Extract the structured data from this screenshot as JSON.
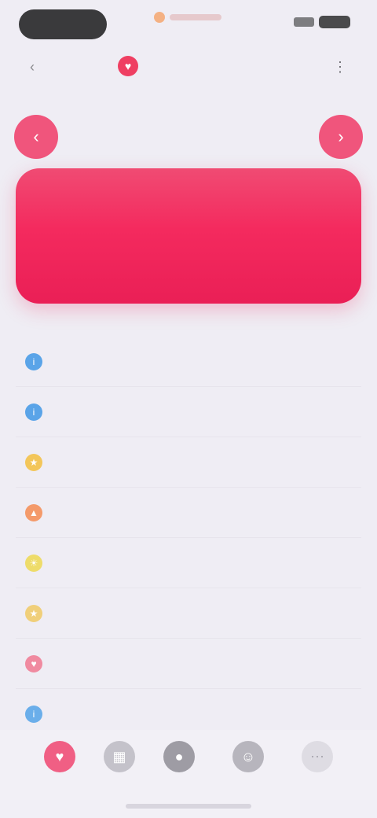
{
  "status_bar": {
    "left_icon": "status-pill",
    "notification_icon": "notification-dot-icon",
    "signal_icon": "signal-icon",
    "battery_icon": "battery-icon"
  },
  "nav": {
    "back_icon": "chevron-left-icon",
    "title_icon": "heart-icon",
    "title": "",
    "menu_icon": "more-icon"
  },
  "pager": {
    "prev_icon": "chevron-left-icon",
    "next_icon": "chevron-right-icon",
    "label": ""
  },
  "hero": {
    "label_top": "",
    "value": "",
    "label_bottom": "",
    "footnote": "",
    "color_top": "#f04b73",
    "color_bottom": "#ea1f56"
  },
  "list": {
    "items": [
      {
        "icon": "info-icon",
        "icon_color": "#5aa4e8",
        "label": "",
        "value": ""
      },
      {
        "icon": "info-icon",
        "icon_color": "#5aa4e8",
        "label": "",
        "value": ""
      },
      {
        "icon": "star-icon",
        "icon_color": "#f3c65a",
        "label": "",
        "value": ""
      },
      {
        "icon": "flame-icon",
        "icon_color": "#f49a6a",
        "label": "",
        "value": ""
      },
      {
        "icon": "sun-icon",
        "icon_color": "#eedc6a",
        "label": "",
        "value": ""
      },
      {
        "icon": "star-icon",
        "icon_color": "#f0cf7a",
        "label": "",
        "value": ""
      },
      {
        "icon": "heart-icon",
        "icon_color": "#f08aa0",
        "label": "",
        "value": ""
      },
      {
        "icon": "info-icon",
        "icon_color": "#6aaeea",
        "label": "",
        "value": ""
      }
    ]
  },
  "tabs": [
    {
      "icon": "heart-icon",
      "color": "#f05f84",
      "label": "",
      "active": true
    },
    {
      "icon": "grid-icon",
      "color": "#c4c2ca",
      "label": "",
      "active": false
    },
    {
      "icon": "circle-icon",
      "color": "#9e9ca4",
      "label": "",
      "active": false
    },
    {
      "icon": "person-icon",
      "color": "#b7b5bd",
      "label": "",
      "active": false
    },
    {
      "icon": "more-icon",
      "color": "#dedce3",
      "label": "",
      "active": false
    }
  ]
}
